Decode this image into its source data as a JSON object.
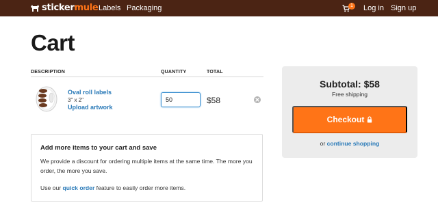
{
  "nav": {
    "logo_part1": "sticker",
    "logo_part2": "mule",
    "links": [
      "Labels",
      "Packaging"
    ],
    "cart_count": "1",
    "login": "Log in",
    "signup": "Sign up"
  },
  "page": {
    "title": "Cart"
  },
  "table": {
    "headers": {
      "description": "DESCRIPTION",
      "quantity": "QUANTITY",
      "total": "TOTAL"
    },
    "item": {
      "name": "Oval roll labels",
      "size": "3\" x 2\"",
      "upload": "Upload artwork",
      "quantity": "50",
      "total": "$58"
    }
  },
  "discount": {
    "title": "Add more items to your cart and save",
    "text": "We provide a discount for ordering multiple items at the same time. The more you order, the more you save.",
    "foot_prefix": "Use our ",
    "foot_link": "quick order",
    "foot_suffix": " feature to easily order more items."
  },
  "summary": {
    "subtotal": "Subtotal: $58",
    "shipping": "Free shipping",
    "checkout": "Checkout",
    "or": "or ",
    "continue": "continue shopping"
  },
  "colors": {
    "brand_bar": "#4b2414",
    "accent": "#ff7417",
    "link": "#2a7ab8"
  }
}
